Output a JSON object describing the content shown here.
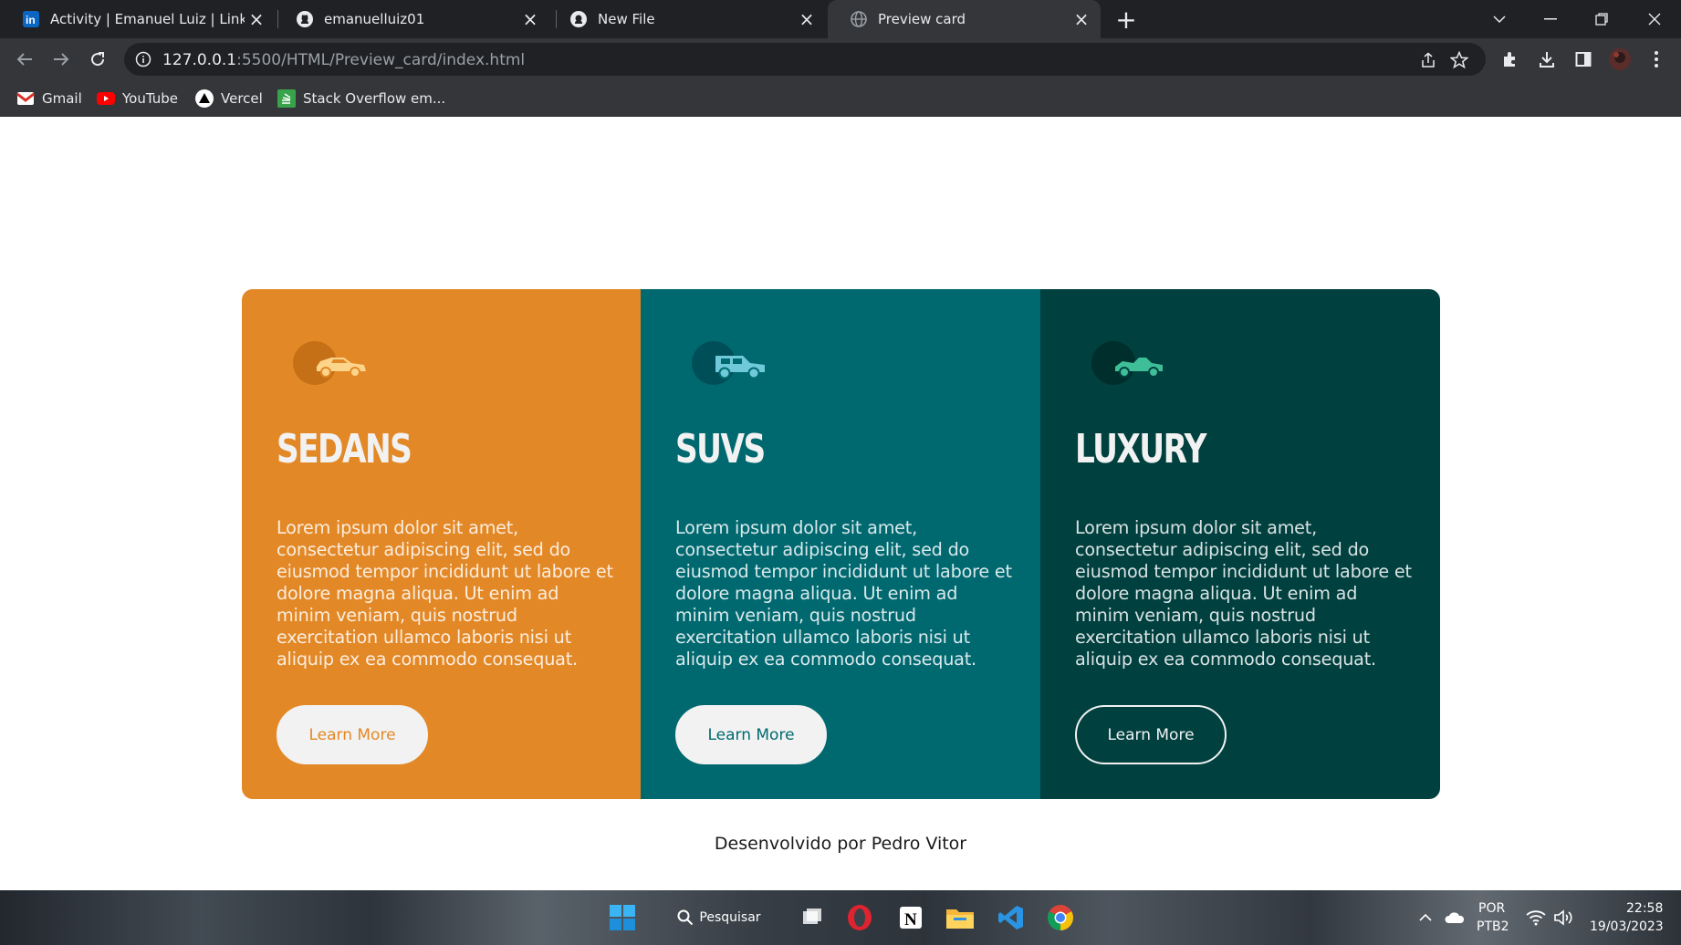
{
  "browser": {
    "tabs": [
      {
        "title": "Activity | Emanuel Luiz | LinkedIn",
        "icon": "linkedin-icon",
        "active": false
      },
      {
        "title": "emanuelluiz01",
        "icon": "github-icon",
        "active": false
      },
      {
        "title": "New File",
        "icon": "github-icon",
        "active": false
      },
      {
        "title": "Preview card",
        "icon": "globe-icon",
        "active": true
      }
    ],
    "url_host": "127.0.0.1",
    "url_rest": ":5500/HTML/Preview_card/index.html",
    "bookmarks": [
      {
        "label": "Gmail",
        "icon": "gmail-icon"
      },
      {
        "label": "YouTube",
        "icon": "youtube-icon"
      },
      {
        "label": "Vercel",
        "icon": "vercel-icon"
      },
      {
        "label": "Stack Overflow em...",
        "icon": "stackoverflow-icon"
      }
    ]
  },
  "cards": [
    {
      "title": "SEDANS",
      "text": "Lorem ipsum dolor sit amet, consectetur adipiscing elit, sed do eiusmod tempor incididunt ut labore et dolore magna aliqua. Ut enim ad minim veniam, quis nostrud exercitation ullamco laboris nisi ut aliquip ex ea commodo consequat.",
      "button": "Learn More",
      "icon": "sedan-car-icon",
      "color": "#e38826"
    },
    {
      "title": "SUVS",
      "text": "Lorem ipsum dolor sit amet, consectetur adipiscing elit, sed do eiusmod tempor incididunt ut labore et dolore magna aliqua. Ut enim ad minim veniam, quis nostrud exercitation ullamco laboris nisi ut aliquip ex ea commodo consequat.",
      "button": "Learn More",
      "icon": "suv-car-icon",
      "color": "#006970"
    },
    {
      "title": "LUXURY",
      "text": "Lorem ipsum dolor sit amet, consectetur adipiscing elit, sed do eiusmod tempor incididunt ut labore et dolore magna aliqua. Ut enim ad minim veniam, quis nostrud exercitation ullamco laboris nisi ut aliquip ex ea commodo consequat.",
      "button": "Learn More",
      "icon": "luxury-car-icon",
      "color": "#00403f"
    }
  ],
  "footer": {
    "text": "Desenvolvido por Pedro Vitor"
  },
  "taskbar": {
    "search_label": "Pesquisar",
    "language": "POR",
    "keyboard": "PTB2",
    "time": "22:58",
    "date": "19/03/2023"
  }
}
